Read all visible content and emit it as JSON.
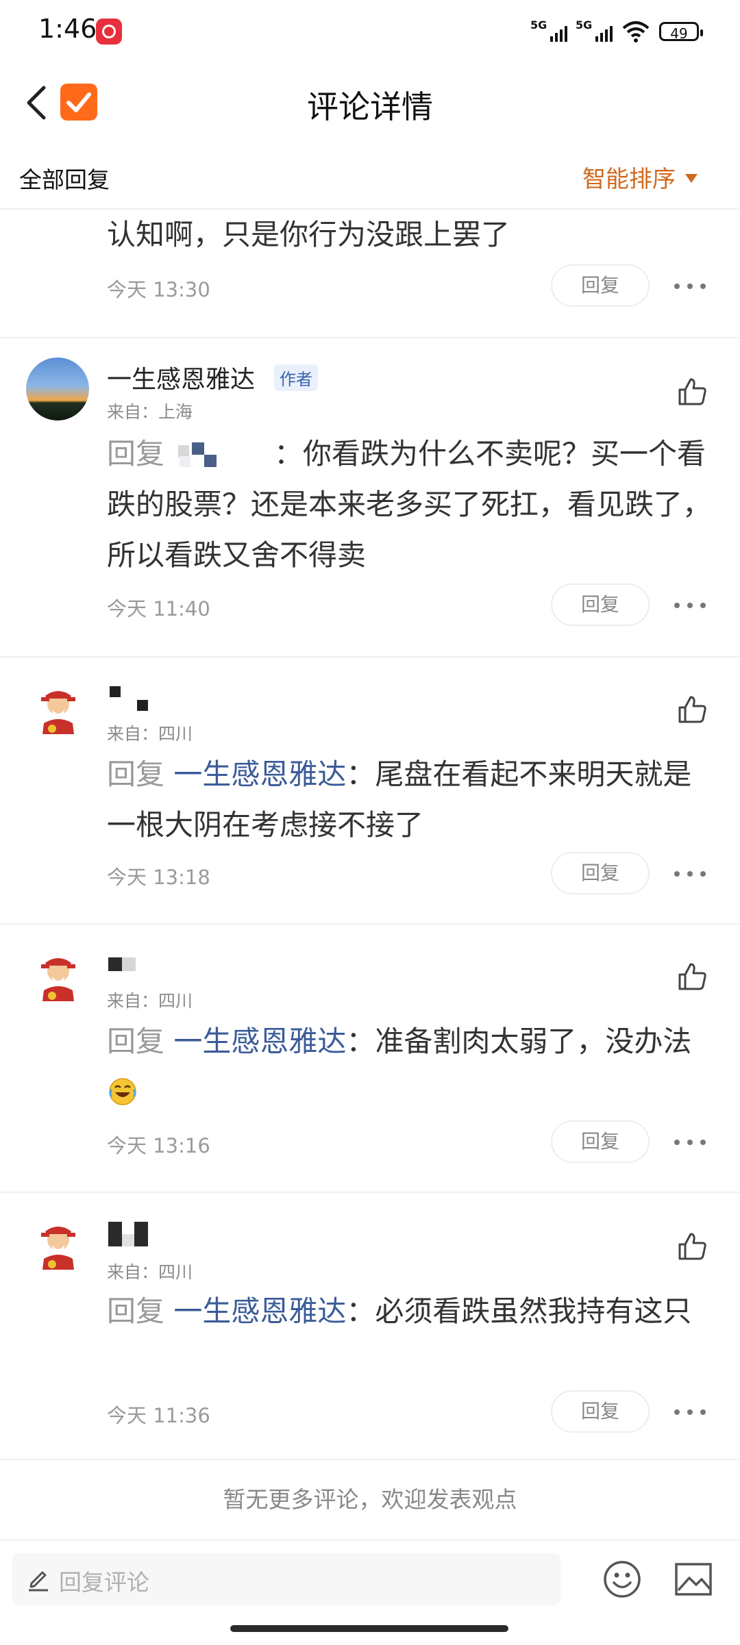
{
  "status_bar": {
    "time": "1:46",
    "signal1_label": "5G",
    "signal2_label": "5G",
    "battery": "49"
  },
  "header": {
    "title": "评论详情"
  },
  "filter": {
    "all_replies": "全部回复",
    "sort_label": "智能排序"
  },
  "comments": [
    {
      "text_tail": "认知啊，只是你行为没跟上罢了",
      "time": "今天 13:30",
      "reply_label": "回复"
    },
    {
      "username": "一生感恩雅达",
      "badge": "作者",
      "location": "来自：上海",
      "reply_prefix": "回复",
      "text": "：你看跌为什么不卖呢？买一个看跌的股票？还是本来老多买了死扛，看见跌了，所以看跌又舍不得卖",
      "time": "今天 11:40",
      "reply_label": "回复"
    },
    {
      "location": "来自：四川",
      "reply_prefix": "回复 ",
      "mention": "一生感恩雅达",
      "text": "：尾盘在看起不来明天就是一根大阴在考虑接不接了",
      "time": "今天 13:18",
      "reply_label": "回复"
    },
    {
      "location": "来自：四川",
      "reply_prefix": "回复 ",
      "mention": "一生感恩雅达",
      "text": "：准备割肉太弱了，没办法",
      "emoji": "laughing-crying",
      "time": "今天 13:16",
      "reply_label": "回复"
    },
    {
      "location": "来自：四川",
      "reply_prefix": "回复 ",
      "mention": "一生感恩雅达",
      "text": "：必须看跌虽然我持有这只",
      "time": "今天 11:36",
      "reply_label": "回复"
    }
  ],
  "footer_note": "暂无更多评论，欢迎发表观点",
  "bottom_bar": {
    "input_placeholder": "回复评论"
  },
  "colors": {
    "accent": "#d2691e",
    "mention": "#3b5c98",
    "brand_logo": "#ff6a1a"
  },
  "icons": [
    "back-arrow-icon",
    "app-logo-icon",
    "thumbs-up-icon",
    "more-dots-icon",
    "pen-icon",
    "emoji-icon",
    "image-icon"
  ]
}
